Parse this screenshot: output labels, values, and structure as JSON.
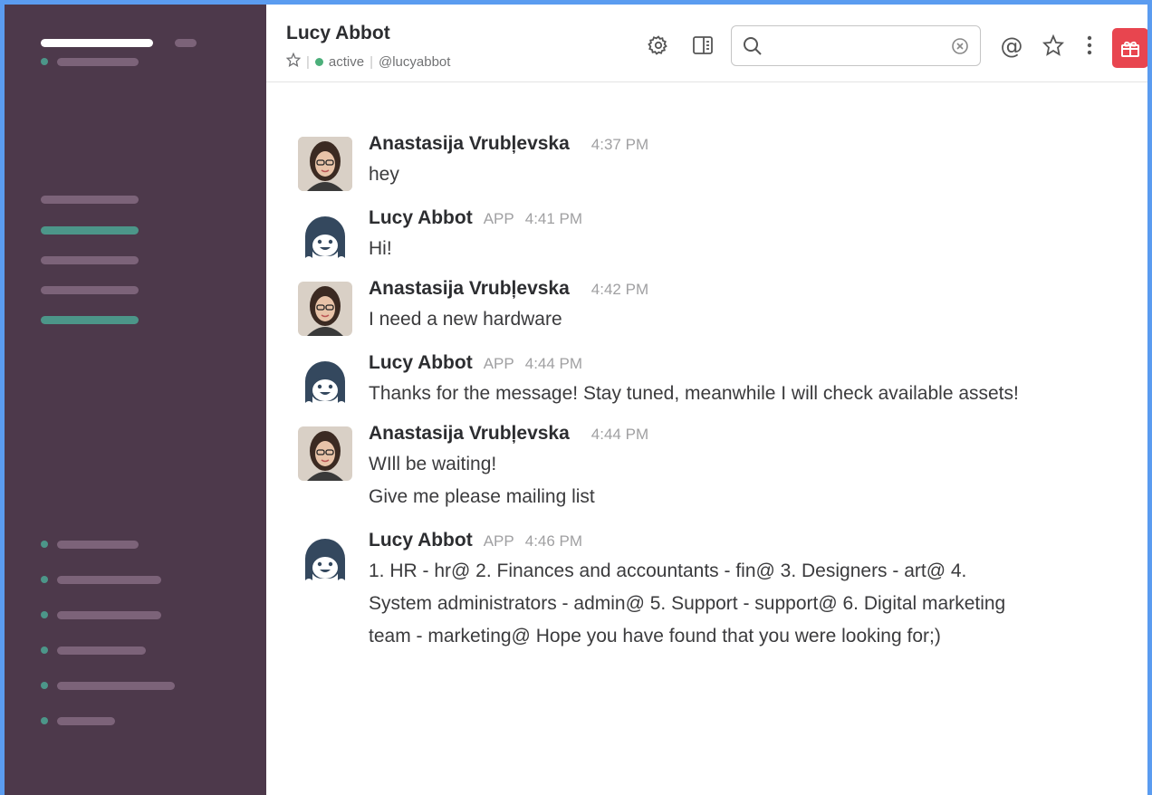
{
  "channel": {
    "title": "Lucy Abbot",
    "status": "active",
    "handle": "@lucyabbot"
  },
  "search": {
    "value": "",
    "placeholder": ""
  },
  "icons": {
    "settings": "gear-icon",
    "details": "sidebar-panel-icon",
    "search": "search-icon",
    "clear": "clear-icon",
    "mentions": "at-icon",
    "starred": "star-icon",
    "more": "more-vertical-icon",
    "whats_new": "gift-icon"
  },
  "colors": {
    "sidebar": "#4d394b",
    "accent_green": "#4c9689",
    "gift_red": "#e8454f",
    "frame_blue": "#5b9cf0"
  },
  "messages": [
    {
      "author": "Anastasija Vrubļevska",
      "app": "",
      "time": "4:37 PM",
      "lines": [
        "hey"
      ],
      "avatar": "user"
    },
    {
      "author": "Lucy Abbot",
      "app": "APP",
      "time": "4:41 PM",
      "lines": [
        "Hi!"
      ],
      "avatar": "bot"
    },
    {
      "author": "Anastasija Vrubļevska",
      "app": "",
      "time": "4:42 PM",
      "lines": [
        "I need a new hardware"
      ],
      "avatar": "user"
    },
    {
      "author": "Lucy Abbot",
      "app": "APP",
      "time": "4:44 PM",
      "lines": [
        "Thanks for the message! Stay tuned, meanwhile I will check available assets!"
      ],
      "avatar": "bot"
    },
    {
      "author": "Anastasija Vrubļevska",
      "app": "",
      "time": "4:44 PM",
      "lines": [
        "WIll be waiting!",
        "Give me please mailing list"
      ],
      "avatar": "user"
    },
    {
      "author": "Lucy Abbot",
      "app": "APP",
      "time": "4:46 PM",
      "lines": [
        "1. HR - hr@ 2. Finances and accountants - fin@ 3. Designers - art@ 4.",
        "System administrators - admin@ 5. Support - support@ 6. Digital marketing",
        "team - marketing@ Hope you have found that you were looking for;)"
      ],
      "avatar": "bot"
    }
  ]
}
